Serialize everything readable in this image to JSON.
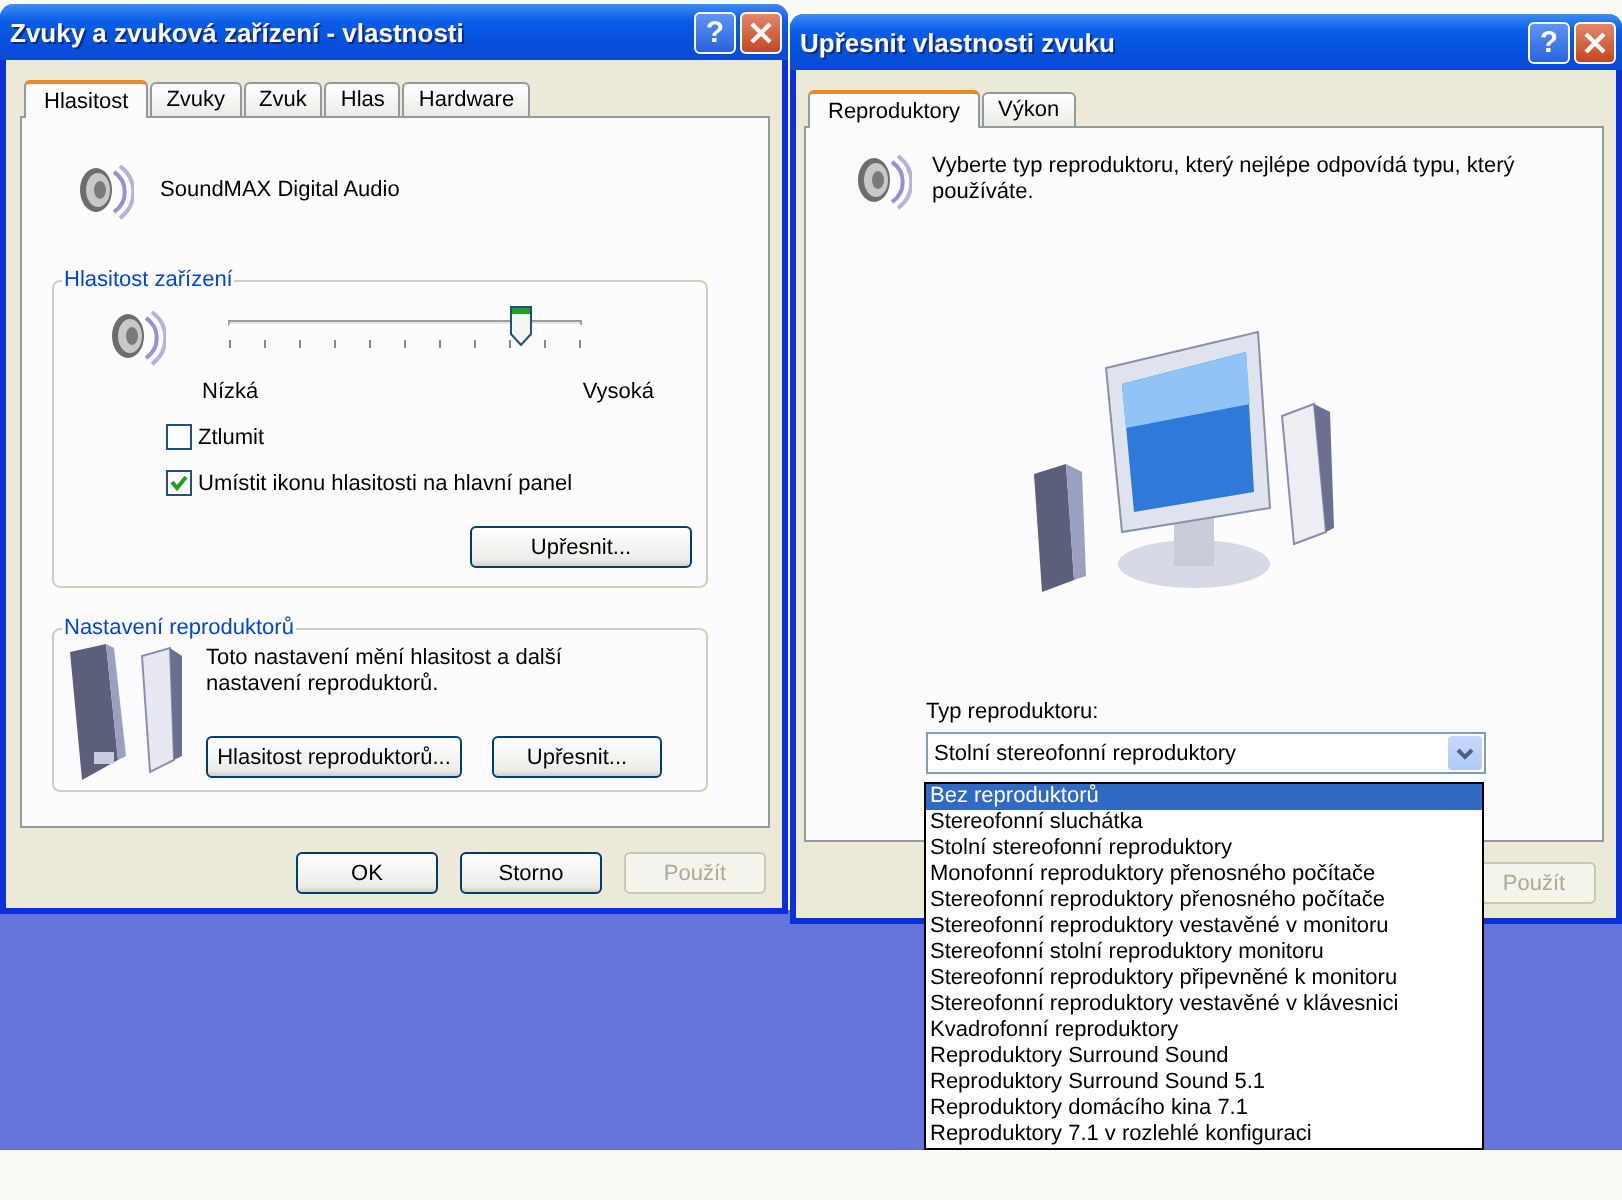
{
  "sound_properties": {
    "title": "Zvuky a zvuková zařízení - vlastnosti",
    "help_button": "?",
    "tabs": [
      {
        "label": "Hlasitost",
        "selected": true
      },
      {
        "label": "Zvuky",
        "selected": false
      },
      {
        "label": "Zvuk",
        "selected": false
      },
      {
        "label": "Hlas",
        "selected": false
      },
      {
        "label": "Hardware",
        "selected": false
      }
    ],
    "device_name": "SoundMAX Digital Audio",
    "volume_group": {
      "title": "Hlasitost zařízení",
      "level": 0.83,
      "low_label": "Nízká",
      "high_label": "Vysoká",
      "checkboxes": [
        {
          "label": "Ztlumit",
          "checked": false
        },
        {
          "label": "Umístit ikonu hlasitosti na hlavní panel",
          "checked": true
        }
      ],
      "advanced_button": "Upřesnit..."
    },
    "speaker_group": {
      "title": "Nastavení reproduktorů",
      "description": "Toto nastavení mění hlasitost a další nastavení reproduktorů.",
      "buttons": [
        "Hlasitost reproduktorů...",
        "Upřesnit..."
      ]
    },
    "buttons": [
      {
        "label": "OK",
        "disabled": false
      },
      {
        "label": "Storno",
        "disabled": false
      },
      {
        "label": "Použít",
        "disabled": true
      }
    ]
  },
  "advanced_properties": {
    "title": "Upřesnit vlastnosti zvuku",
    "help_button": "?",
    "tabs": [
      {
        "label": "Reproduktory",
        "selected": true
      },
      {
        "label": "Výkon",
        "selected": false
      }
    ],
    "description": "Vyberte typ reproduktoru, který nejlépe odpovídá typu, který používáte.",
    "type_label": "Typ reproduktoru:",
    "speaker_type": {
      "value": "Stolní stereofonní reproduktory"
    },
    "dropdown_options": [
      {
        "label": "Bez reproduktorů",
        "selected": true
      },
      {
        "label": "Stereofonní sluchátka",
        "selected": false
      },
      {
        "label": "Stolní stereofonní reproduktory",
        "selected": false
      },
      {
        "label": "Monofonní reproduktory přenosného počítače",
        "selected": false
      },
      {
        "label": "Stereofonní reproduktory přenosného počítače",
        "selected": false
      },
      {
        "label": "Stereofonní reproduktory vestavěné v monitoru",
        "selected": false
      },
      {
        "label": "Stereofonní stolní reproduktory monitoru",
        "selected": false
      },
      {
        "label": "Stereofonní reproduktory připevněné k monitoru",
        "selected": false
      },
      {
        "label": "Stereofonní reproduktory vestavěné v klávesnici",
        "selected": false
      },
      {
        "label": "Kvadrofonní reproduktory",
        "selected": false
      },
      {
        "label": "Reproduktory Surround Sound",
        "selected": false
      },
      {
        "label": "Reproduktory Surround Sound 5.1",
        "selected": false
      },
      {
        "label": "Reproduktory domácího kina 7.1",
        "selected": false
      },
      {
        "label": "Reproduktory 7.1 v rozlehlé konfiguraci",
        "selected": false
      }
    ],
    "buttons": [
      {
        "label": "Použít",
        "disabled": true
      }
    ]
  }
}
